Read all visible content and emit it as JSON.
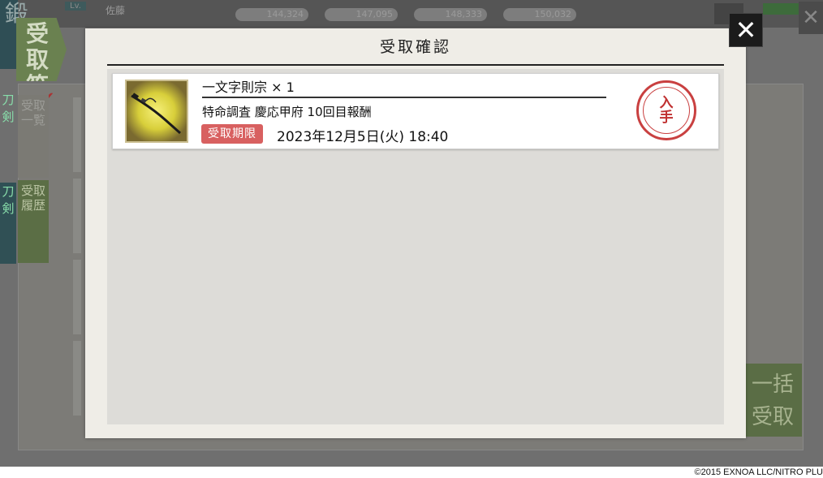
{
  "background": {
    "level_label": "Lv.",
    "player_name": "佐藤",
    "resources": [
      "144,324",
      "147,095",
      "148,333",
      "150,032"
    ],
    "screen_title": "鍛",
    "page_tab": "受取箱",
    "side_tabs": [
      "受取一覧",
      "受取履歴"
    ],
    "left_stubs": [
      "刀剣",
      "刀剣"
    ],
    "bulk_button": "一括受取"
  },
  "modal": {
    "title": "受取確認",
    "close_symbol": "✕",
    "items": [
      {
        "name": "一文字則宗 × 1",
        "source": "特命調査 慶応甲府 10回目報酬",
        "limit_label": "受取期限",
        "limit_date": "2023年12月5日(火) 18:40",
        "stamp": "入手",
        "icon": "sword-icon"
      }
    ]
  },
  "footer": {
    "copyright": "©2015 EXNOA LLC/NITRO PLU"
  },
  "colors": {
    "dim_background": "#6f6f6f",
    "modal_background": "#efede7",
    "list_background": "#dddcd8",
    "badge_red": "#d86060",
    "stamp_red": "#c94040"
  }
}
